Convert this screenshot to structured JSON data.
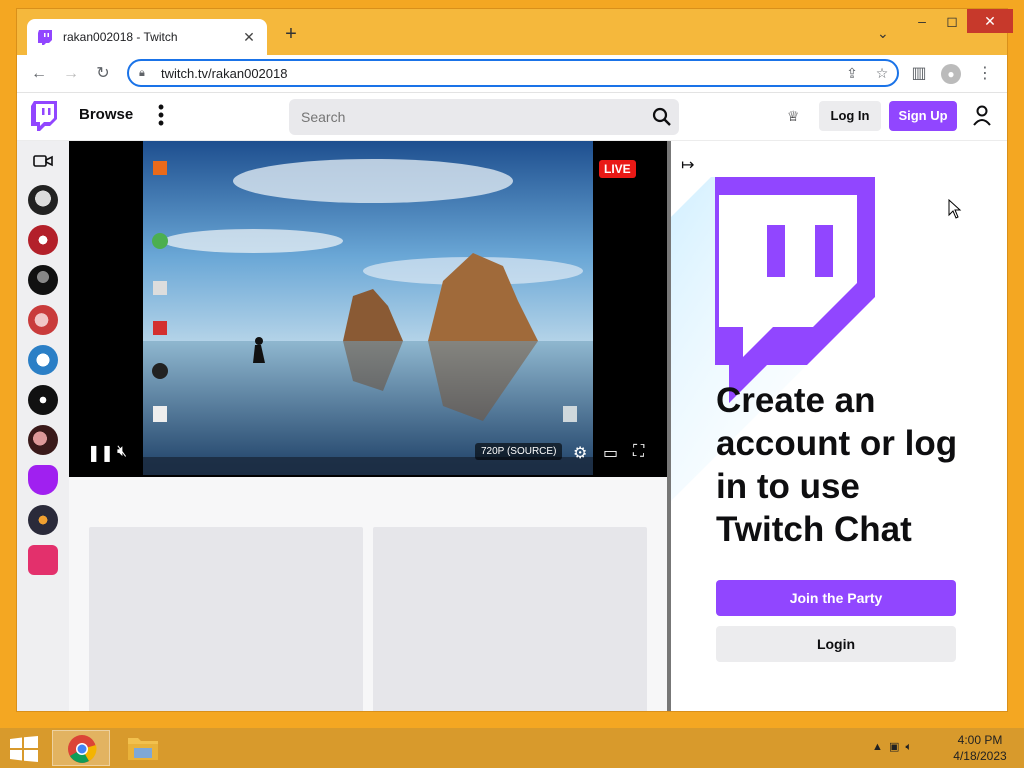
{
  "browser": {
    "tab_title": "rakan002018 - Twitch",
    "new_tab": "+",
    "url": "twitch.tv/rakan002018",
    "window_controls": {
      "minimize": "–",
      "maximize": "◻",
      "close": "✕"
    }
  },
  "twitch": {
    "nav": {
      "browse": "Browse",
      "search_placeholder": "Search",
      "login": "Log In",
      "signup": "Sign Up"
    },
    "player": {
      "live_badge": "LIVE",
      "quality": "720P (SOURCE)"
    },
    "chat": {
      "title": "Create an account or log in to use Twitch Chat",
      "join_button": "Join the Party",
      "login_button": "Login"
    },
    "accent_color": "#9146ff"
  },
  "taskbar": {
    "time": "4:00 PM",
    "date": "4/18/2023"
  }
}
